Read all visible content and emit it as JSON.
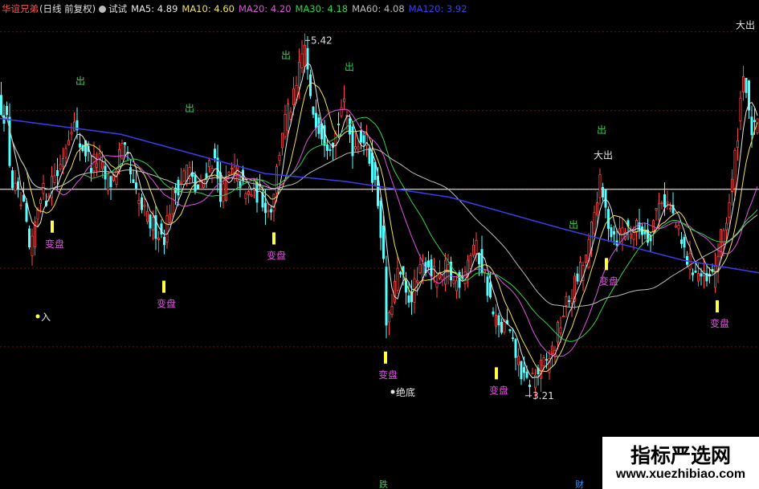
{
  "header": {
    "stock_name": "华谊兄弟",
    "period": "(日线 前复权)",
    "indicator_name": "试试",
    "ma": [
      {
        "label": "MA5:",
        "value": "4.89",
        "color": "#e8e8e8"
      },
      {
        "label": "MA10:",
        "value": "4.60",
        "color": "#f2e25a"
      },
      {
        "label": "MA20:",
        "value": "4.20",
        "color": "#e052e0"
      },
      {
        "label": "MA30:",
        "value": "4.18",
        "color": "#2fd34c"
      },
      {
        "label": "MA60:",
        "value": "4.08",
        "color": "#bdbdbd"
      },
      {
        "label": "MA120:",
        "value": "3.92",
        "color": "#3d3df0"
      }
    ]
  },
  "colors": {
    "up": "#ff4545",
    "down": "#54ffff",
    "ma5": "#e8e8e8",
    "ma10": "#f2e25a",
    "ma20": "#e052e0",
    "ma30": "#2fd34c",
    "ma60": "#bdbdbd",
    "ma120": "#3d3df0",
    "signal_sell": "#2fd34c",
    "signal_buy": "#e052e0",
    "marker": "#ffff44",
    "reference_line": "#ffffff",
    "grid": "#8b0000"
  },
  "chart_data": {
    "type": "candlestick",
    "ylim": [
      3.0,
      5.6
    ],
    "reference_price": 4.5,
    "annotations": {
      "high_label": "5.42",
      "low_label": "3.21",
      "entry_label": "入",
      "bottom_label": "绝底",
      "big_sell_label": "大出",
      "sell_label": "出",
      "change_label": "变盘"
    },
    "ma_current": {
      "MA5": 4.89,
      "MA10": 4.6,
      "MA20": 4.2,
      "MA30": 4.18,
      "MA60": 4.08,
      "MA120": 3.92
    },
    "keys": [
      [
        0,
        5.05
      ],
      [
        8,
        4.95
      ],
      [
        14,
        4.55
      ],
      [
        22,
        4.45
      ],
      [
        30,
        4.35
      ],
      [
        38,
        4.05
      ],
      [
        44,
        4.3
      ],
      [
        50,
        4.5
      ],
      [
        58,
        4.45
      ],
      [
        66,
        4.6
      ],
      [
        72,
        4.6
      ],
      [
        80,
        4.75
      ],
      [
        90,
        4.95
      ],
      [
        98,
        4.8
      ],
      [
        106,
        4.75
      ],
      [
        114,
        4.65
      ],
      [
        122,
        4.7
      ],
      [
        132,
        4.55
      ],
      [
        140,
        4.55
      ],
      [
        150,
        4.75
      ],
      [
        158,
        4.7
      ],
      [
        166,
        4.5
      ],
      [
        174,
        4.4
      ],
      [
        184,
        4.3
      ],
      [
        194,
        4.25
      ],
      [
        204,
        4.2
      ],
      [
        214,
        4.45
      ],
      [
        224,
        4.55
      ],
      [
        234,
        4.65
      ],
      [
        242,
        4.5
      ],
      [
        250,
        4.5
      ],
      [
        258,
        4.65
      ],
      [
        266,
        4.7
      ],
      [
        276,
        4.45
      ],
      [
        286,
        4.6
      ],
      [
        296,
        4.6
      ],
      [
        306,
        4.45
      ],
      [
        316,
        4.5
      ],
      [
        326,
        4.45
      ],
      [
        336,
        4.35
      ],
      [
        344,
        4.6
      ],
      [
        352,
        4.9
      ],
      [
        360,
        5.0
      ],
      [
        368,
        5.1
      ],
      [
        374,
        5.3
      ],
      [
        380,
        5.42
      ],
      [
        386,
        5.05
      ],
      [
        394,
        4.95
      ],
      [
        402,
        4.85
      ],
      [
        410,
        4.8
      ],
      [
        418,
        4.85
      ],
      [
        426,
        5.05
      ],
      [
        432,
        4.95
      ],
      [
        440,
        4.75
      ],
      [
        448,
        4.85
      ],
      [
        456,
        4.8
      ],
      [
        462,
        4.65
      ],
      [
        470,
        4.45
      ],
      [
        476,
        4.15
      ],
      [
        482,
        3.55
      ],
      [
        488,
        3.8
      ],
      [
        494,
        3.95
      ],
      [
        500,
        3.95
      ],
      [
        506,
        3.8
      ],
      [
        514,
        3.85
      ],
      [
        522,
        3.95
      ],
      [
        532,
        4.05
      ],
      [
        540,
        3.95
      ],
      [
        548,
        3.9
      ],
      [
        556,
        4.0
      ],
      [
        566,
        3.9
      ],
      [
        574,
        3.95
      ],
      [
        582,
        4.05
      ],
      [
        590,
        4.15
      ],
      [
        598,
        4.05
      ],
      [
        606,
        3.9
      ],
      [
        614,
        3.7
      ],
      [
        622,
        3.6
      ],
      [
        630,
        3.65
      ],
      [
        638,
        3.5
      ],
      [
        646,
        3.4
      ],
      [
        654,
        3.25
      ],
      [
        662,
        3.3
      ],
      [
        672,
        3.35
      ],
      [
        680,
        3.4
      ],
      [
        690,
        3.5
      ],
      [
        700,
        3.7
      ],
      [
        708,
        3.8
      ],
      [
        716,
        3.9
      ],
      [
        724,
        4.0
      ],
      [
        732,
        4.1
      ],
      [
        740,
        4.35
      ],
      [
        746,
        4.55
      ],
      [
        752,
        4.4
      ],
      [
        760,
        4.25
      ],
      [
        768,
        4.2
      ],
      [
        776,
        4.25
      ],
      [
        784,
        4.25
      ],
      [
        792,
        4.25
      ],
      [
        800,
        4.25
      ],
      [
        808,
        4.2
      ],
      [
        816,
        4.35
      ],
      [
        824,
        4.45
      ],
      [
        832,
        4.4
      ],
      [
        840,
        4.3
      ],
      [
        848,
        4.15
      ],
      [
        856,
        4.05
      ],
      [
        864,
        4.0
      ],
      [
        872,
        3.95
      ],
      [
        880,
        3.9
      ],
      [
        888,
        3.95
      ],
      [
        896,
        4.15
      ],
      [
        904,
        4.3
      ],
      [
        912,
        4.55
      ],
      [
        920,
        4.95
      ],
      [
        926,
        5.3
      ],
      [
        932,
        4.95
      ],
      [
        938,
        4.85
      ],
      [
        945,
        4.9
      ]
    ],
    "signals": [
      {
        "x": 100,
        "type": "sell"
      },
      {
        "x": 236,
        "type": "sell"
      },
      {
        "x": 356,
        "type": "sell"
      },
      {
        "x": 435,
        "type": "sell"
      },
      {
        "x": 714,
        "type": "sell"
      },
      {
        "x": 749,
        "type": "sell"
      },
      {
        "x": 749,
        "type": "big_sell"
      },
      {
        "x": 926,
        "type": "big_sell"
      },
      {
        "x": 65,
        "type": "change"
      },
      {
        "x": 204,
        "type": "change"
      },
      {
        "x": 341,
        "type": "change"
      },
      {
        "x": 480,
        "type": "change"
      },
      {
        "x": 618,
        "type": "change"
      },
      {
        "x": 755,
        "type": "change"
      },
      {
        "x": 893,
        "type": "change"
      },
      {
        "x": 50,
        "type": "entry"
      },
      {
        "x": 492,
        "type": "bottom"
      }
    ]
  },
  "footer": {
    "markers": [
      "跌",
      "财"
    ]
  },
  "watermark": {
    "line1": "指标严选网",
    "line2": "www.xuezhibiao.com"
  }
}
